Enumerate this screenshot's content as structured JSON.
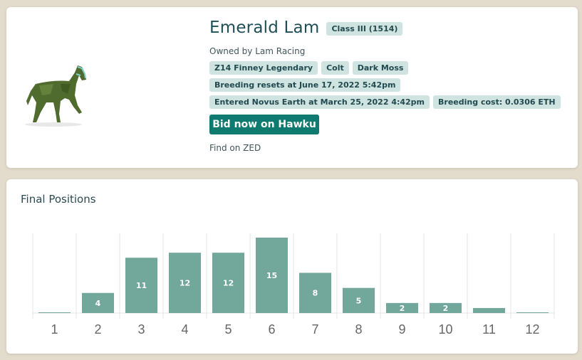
{
  "horse": {
    "name": "Emerald Lam",
    "class_badge": "Class III (1514)",
    "owner": "Owned by Lam Racing",
    "tags_row1": [
      "Z14 Finney Legendary",
      "Colt",
      "Dark Moss"
    ],
    "breeding_reset": "Breeding resets at June 17, 2022 5:42pm",
    "entered": "Entered Novus Earth at March 25, 2022 4:42pm",
    "breeding_cost": "Breeding cost: 0.0306 ETH",
    "bid_button": "Bid now on Hawku",
    "find_link": "Find on ZED",
    "image_icon": "horse-icon"
  },
  "chart_data": {
    "type": "bar",
    "title": "Final Positions",
    "categories": [
      "1",
      "2",
      "3",
      "4",
      "5",
      "6",
      "7",
      "8",
      "9",
      "10",
      "11",
      "12"
    ],
    "values": [
      0,
      4,
      11,
      12,
      12,
      15,
      8,
      5,
      2,
      2,
      1,
      0
    ],
    "labels": [
      "",
      "4",
      "11",
      "12",
      "12",
      "15",
      "8",
      "5",
      "2",
      "2",
      "",
      ""
    ],
    "ylim": [
      0,
      15
    ],
    "grid": true,
    "bar_color": "#72a89b",
    "label_color": "#ffffff"
  },
  "colors": {
    "background": "#e3dccd",
    "accent": "#0f7a70",
    "badge_bg": "#cfe3e1",
    "text": "#1f4f56"
  }
}
